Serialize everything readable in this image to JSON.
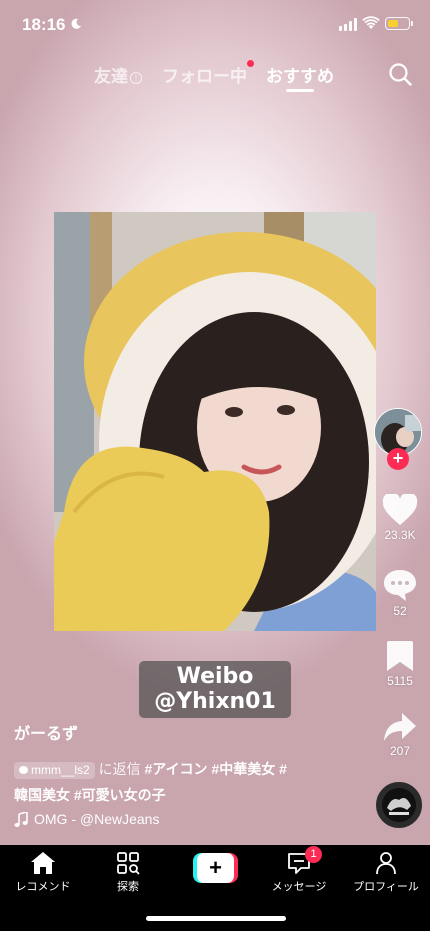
{
  "status_bar": {
    "time": "18:16"
  },
  "top_tabs": {
    "friends": "友達",
    "following": "フォロー中",
    "for_you": "おすすめ"
  },
  "post": {
    "watermark_line1": "Weibo",
    "watermark_line2": "@Yhixn01",
    "username": "がーるず",
    "reply_user": "mmm__ls2",
    "reply_text": "に返信",
    "hashtags_line1": "#アイコン #中華美女 #",
    "hashtags_line2": "韓国美女 #可愛い女の子",
    "music": "OMG - @NewJeans"
  },
  "actions": {
    "likes": "23.3K",
    "comments": "52",
    "saves": "5115",
    "shares": "207"
  },
  "bottom_nav": {
    "home": "レコメンド",
    "discover": "探索",
    "create": "+",
    "inbox": "メッセージ",
    "inbox_badge": "1",
    "profile": "プロフィール"
  },
  "colors": {
    "accent": "#fe2c55",
    "cyan": "#25f4ee",
    "battery": "#f7d031"
  }
}
